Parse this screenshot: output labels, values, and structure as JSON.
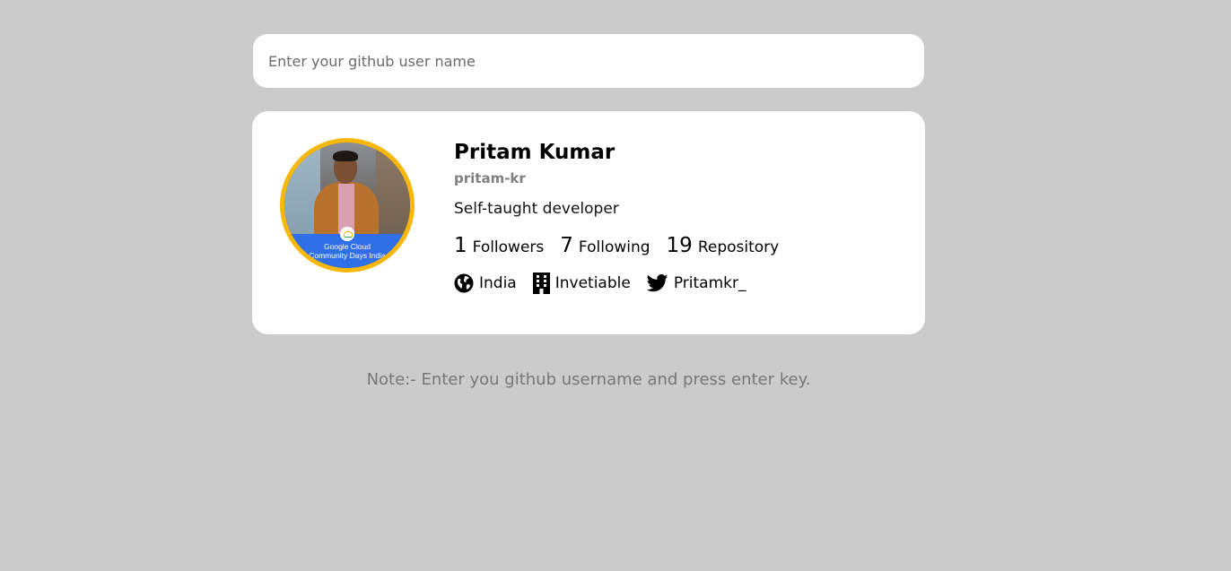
{
  "search": {
    "placeholder": "Enter your github user name",
    "value": ""
  },
  "profile": {
    "avatar_banner_line1": "Google Cloud",
    "avatar_banner_line2": "Community Days India",
    "name": "Pritam Kumar",
    "username": "pritam-kr",
    "bio": "Self-taught developer",
    "stats": {
      "followers_count": "1",
      "followers_label": "Followers",
      "following_count": "7",
      "following_label": "Following",
      "repos_count": "19",
      "repos_label": "Repository"
    },
    "location": {
      "icon": "globe-icon",
      "text": "India"
    },
    "company": {
      "icon": "building-icon",
      "text": "Invetiable"
    },
    "twitter": {
      "icon": "twitter-icon",
      "text": "Pritamkr_"
    }
  },
  "note": "Note:- Enter you github username and press enter key.",
  "colors": {
    "page_background": "#cbcbcb",
    "card_background": "#ffffff",
    "avatar_ring": "#f7b70b",
    "banner_blue": "#2f6fe8",
    "muted_text": "#808080"
  }
}
